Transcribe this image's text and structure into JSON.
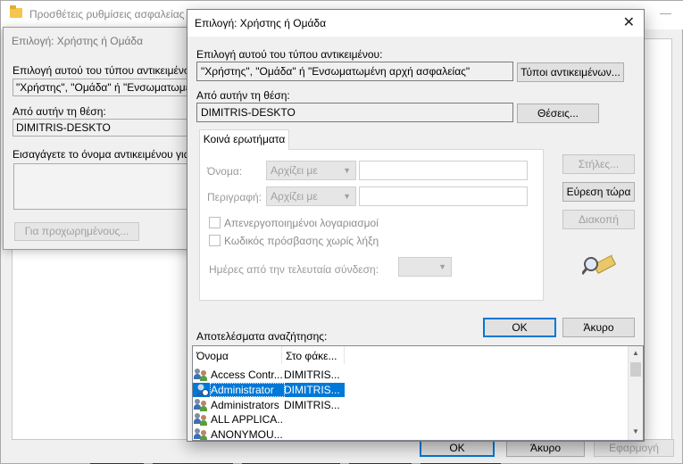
{
  "background_window": {
    "title": "Προσθέτεις ρυθμίσεις ασφαλείας",
    "minimize": "—",
    "close": "✕",
    "buttons": {
      "ok": "OK",
      "cancel": "Άκυρο",
      "apply": "Εφαρμογή"
    }
  },
  "middle_window": {
    "title": "Επιλογή: Χρήστης ή Ομάδα",
    "object_type_label": "Επιλογή αυτού του τύπου αντικειμένου:",
    "object_type_value": "\"Χρήστης\", \"Ομάδα\" ή \"Ενσωματωμένη",
    "location_label": "Από αυτήν τη θέση:",
    "location_value": "DIMITRIS-DESKTO",
    "enter_names_label": "Εισαγάγετε το όνομα αντικειμένου για",
    "advanced_button": "Για προχωρημένους..."
  },
  "dialog": {
    "title": "Επιλογή: Χρήστης ή Ομάδα",
    "close_icon": "close-icon",
    "object_type_label": "Επιλογή αυτού του τύπου αντικειμένου:",
    "object_type_value": "\"Χρήστης\", \"Ομάδα\" ή \"Ενσωματωμένη αρχή ασφαλείας\"",
    "object_types_button": "Τύποι αντικειμένων...",
    "location_label": "Από αυτήν τη θέση:",
    "location_value": "DIMITRIS-DESKTO",
    "locations_button": "Θέσεις...",
    "tab_common_queries": "Κοινά ερωτήματα",
    "query": {
      "name_label": "Όνομα:",
      "name_match": "Αρχίζει με",
      "description_label": "Περιγραφή:",
      "description_match": "Αρχίζει με",
      "disabled_accounts": "Απενεργοποιημένοι λογαριασμοί",
      "non_expiring_passwords": "Κωδικός πρόσβασης χωρίς λήξη",
      "days_since_last_logon": "Ημέρες από την τελευταία σύνδεση:"
    },
    "columns_button": "Στήλες...",
    "find_now_button": "Εύρεση τώρα",
    "stop_button": "Διακοπή",
    "ok_button": "OK",
    "cancel_button": "Άκυρο",
    "results_label": "Αποτελέσματα αναζήτησης:",
    "results": {
      "columns": [
        "Όνομα",
        "Στο φάκε..."
      ],
      "rows": [
        {
          "name": "Access Contr...",
          "folder": "DIMITRIS...",
          "icon": "group-icon",
          "selected": false
        },
        {
          "name": "Administrator",
          "folder": "DIMITRIS...",
          "icon": "user-icon",
          "selected": true
        },
        {
          "name": "Administrators",
          "folder": "DIMITRIS...",
          "icon": "group-icon",
          "selected": false
        },
        {
          "name": "ALL APPLICA...",
          "folder": "",
          "icon": "group-icon",
          "selected": false
        },
        {
          "name": "ANONYMOU...",
          "folder": "",
          "icon": "group-icon",
          "selected": false
        }
      ]
    }
  },
  "colors": {
    "selection": "#0078d7",
    "dialog_bg": "#f0f0f0",
    "disabled_text": "#a0a0a0"
  }
}
